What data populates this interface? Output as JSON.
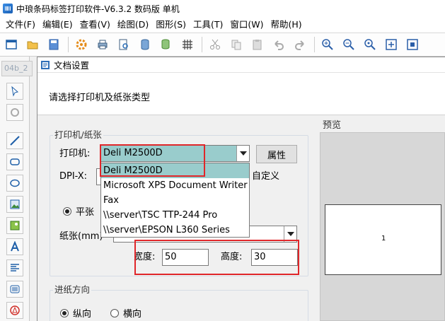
{
  "app": {
    "title": "中琅条码标签打印软件-V6.3.2 数码版 单机"
  },
  "menu": [
    "文件(F)",
    "编辑(E)",
    "查看(V)",
    "绘图(D)",
    "图形(S)",
    "工具(T)",
    "窗口(W)",
    "帮助(H)"
  ],
  "leftbar": {
    "tab_label": "04b_2"
  },
  "dialog": {
    "title": "文档设置",
    "instruction": "请选择打印机及纸张类型",
    "printer_group": {
      "legend": "打印机/纸张",
      "printer_label": "打印机:",
      "printer_value": "Deli M2500D",
      "properties_button": "属性",
      "dpi_label": "DPI-X:",
      "custom_label": "自定义",
      "flat_radio": "平张",
      "paper_label": "纸张(mm)",
      "width_label": "宽度:",
      "width_value": "50",
      "height_label": "高度:",
      "height_value": "30"
    },
    "printer_options": [
      "Deli M2500D",
      "Microsoft XPS Document Writer",
      "Fax",
      "\\\\server\\TSC TTP-244 Pro",
      "\\\\server\\EPSON L360 Series"
    ],
    "feed_group": {
      "legend": "进纸方向",
      "portrait": "纵向",
      "landscape": "横向"
    },
    "preview": {
      "legend": "预览",
      "label_number": "1"
    }
  },
  "colors": {
    "highlight": "#e0262a",
    "selected": "#99cccc"
  }
}
